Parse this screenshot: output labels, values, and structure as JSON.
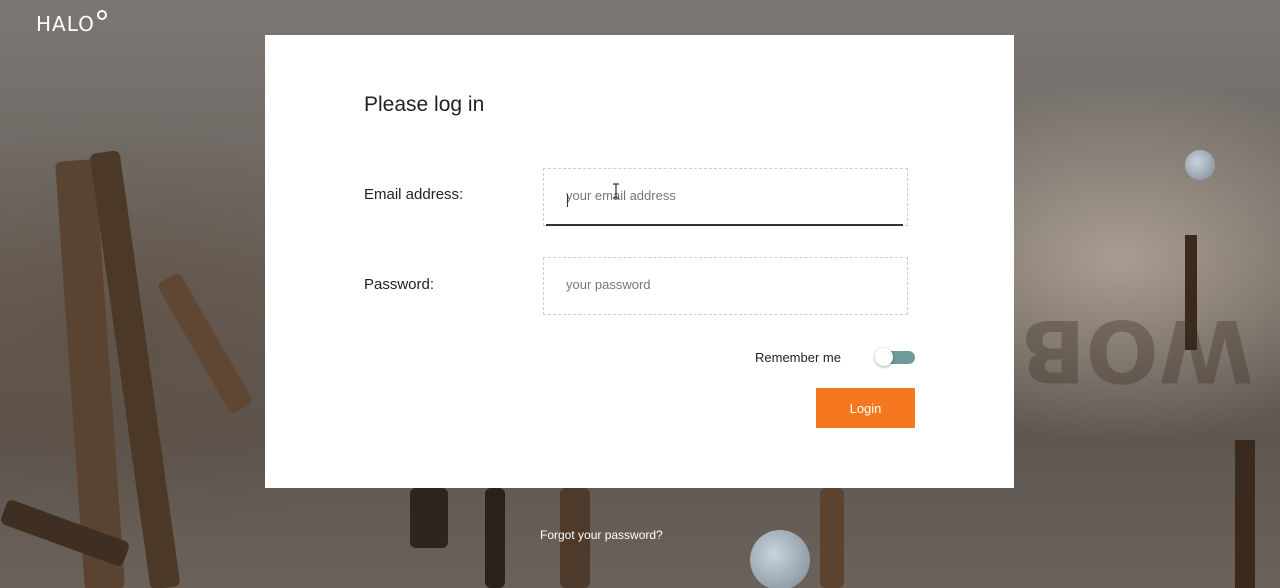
{
  "brand": {
    "logo_text": "HALO"
  },
  "form": {
    "title": "Please log in",
    "email": {
      "label": "Email address:",
      "placeholder": "your email address"
    },
    "password": {
      "label": "Password:",
      "placeholder": "your password"
    },
    "remember": {
      "label": "Remember me",
      "on": true
    },
    "login_label": "Login"
  },
  "footer": {
    "forgot_label": "Forgot your password?"
  },
  "colors": {
    "accent": "#f5781f",
    "toggle_track": "#6f9c9a"
  },
  "icons": {
    "cursor": "text-cursor-icon",
    "logo_mark": "ring-icon"
  }
}
